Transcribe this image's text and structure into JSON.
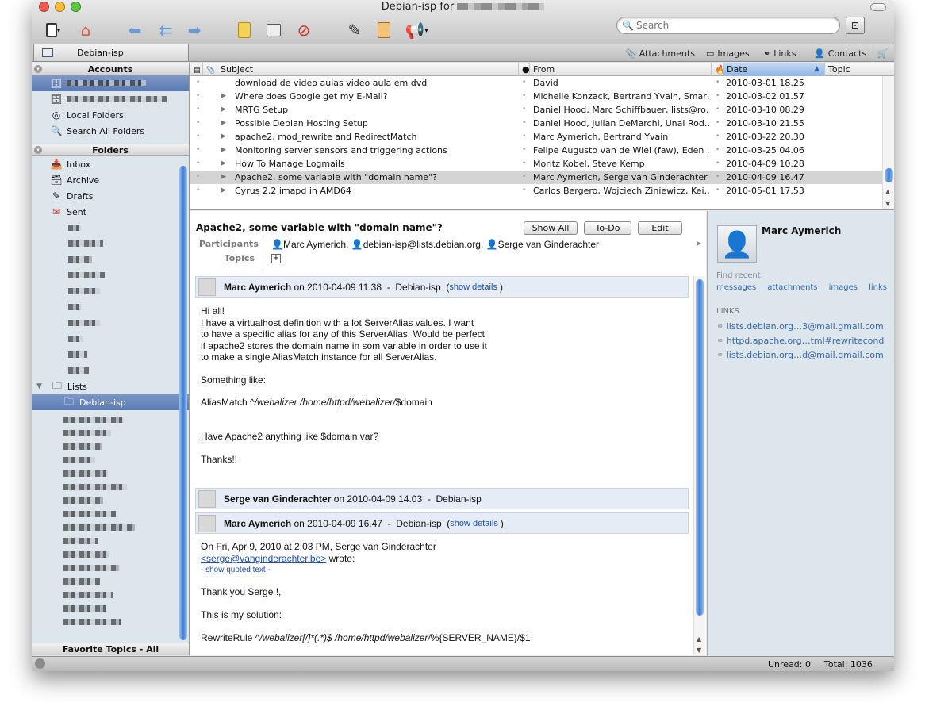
{
  "window": {
    "title": "Debian-isp for",
    "colors": {
      "close": "#ef5a52",
      "minimize": "#f5bd3a",
      "zoom": "#5cc943",
      "selection": "#5a7ab3"
    }
  },
  "toolbar": {
    "icons": [
      "mailbox-icon",
      "home-icon",
      "reply-icon",
      "reply-all-icon",
      "forward-icon",
      "note-icon",
      "archive-icon",
      "delete-icon",
      "compose-icon",
      "clipboard-icon",
      "megaphone-icon"
    ],
    "search_placeholder": "Search"
  },
  "tabbar": {
    "main_tab": "Debian-isp",
    "attachments": "Attachments",
    "images": "Images",
    "links": "Links",
    "contacts": "Contacts"
  },
  "sidebar": {
    "accounts_header": "Accounts",
    "local_folders": "Local Folders",
    "search_all": "Search All Folders",
    "folders_header": "Folders",
    "folders": [
      {
        "label": "Inbox",
        "icon": "inbox-icon"
      },
      {
        "label": "Archive",
        "icon": "archive-icon"
      },
      {
        "label": "Drafts",
        "icon": "drafts-icon"
      },
      {
        "label": "Sent",
        "icon": "sent-icon"
      }
    ],
    "lists": "Lists",
    "selected_list": "Debian-isp",
    "favorite_topics": "Favorite Topics - All"
  },
  "list": {
    "columns": {
      "subject": "Subject",
      "from": "From",
      "date": "Date",
      "topic": "Topic"
    },
    "rows": [
      {
        "subject": "download de video aulas video aula em dvd",
        "from": "David",
        "date": "2010-03-01 18.25",
        "thread": false
      },
      {
        "subject": "Where does Google get my E-Mail?",
        "from": "Michelle Konzack, Bertrand Yvain, Smar…",
        "date": "2010-03-02 01.57",
        "thread": true
      },
      {
        "subject": "MRTG Setup",
        "from": "Daniel Hood, Marc Schiffbauer, lists@ro…",
        "date": "2010-03-10 08.29",
        "thread": true
      },
      {
        "subject": "Possible Debian Hosting Setup",
        "from": "Daniel Hood, Julian DeMarchi, Unai Rod…",
        "date": "2010-03-10 21.55",
        "thread": true
      },
      {
        "subject": "apache2, mod_rewrite and RedirectMatch",
        "from": "Marc Aymerich, Bertrand Yvain",
        "date": "2010-03-22 20.30",
        "thread": true
      },
      {
        "subject": "Monitoring server sensors and triggering actions",
        "from": "Felipe Augusto van de Wiel (faw), Eden …",
        "date": "2010-03-25 04.06",
        "thread": true
      },
      {
        "subject": "How To Manage Logmails",
        "from": "Moritz Kobel, Steve Kemp",
        "date": "2010-04-09 10.28",
        "thread": true
      },
      {
        "subject": "Apache2, some variable with \"domain name\"?",
        "from": "Marc Aymerich, Serge van Ginderachter",
        "date": "2010-04-09 16.47",
        "thread": true,
        "selected": true
      },
      {
        "subject": "Cyrus 2.2 imapd in AMD64",
        "from": "Carlos Bergero, Wojciech Ziniewicz, Kei…",
        "date": "2010-05-01 17.53",
        "thread": true
      }
    ]
  },
  "reader": {
    "title": "Apache2, some variable with \"domain name\"?",
    "show_all": "Show All",
    "todo": "To-Do",
    "edit": "Edit",
    "participants_label": "Participants",
    "topics_label": "Topics",
    "participants": [
      "Marc Aymerich,",
      "debian-isp@lists.debian.org,",
      "Serge van Ginderachter"
    ],
    "messages": [
      {
        "sender": "Marc Aymerich",
        "meta": " on 2010-04-09 11.38  -  Debian-isp  (",
        "details": "show details",
        "close": ")",
        "body": "Hi all!\nI have a virtualhost definition with a lot ServerAlias values. I want\nto have a specific alias for any of this ServerAlias. Would be perfect\nif apache2 stores the domain name in som variable in order to use it\nto make a single AliasMatch instance for all ServerAlias.\n\nSomething like:"
      },
      {
        "sender": "Serge van Ginderachter",
        "meta": " on 2010-04-09 14.03  -  Debian-isp"
      },
      {
        "sender": "Marc Aymerich",
        "meta": " on 2010-04-09 16.47  -  Debian-isp  (",
        "details": "show details",
        "close": ")"
      }
    ],
    "alias_pre": "AliasMatch ^",
    "alias_it": "/webalizer /home/httpd/webalizer/",
    "alias_post": "$domain",
    "body1_tail": "Have Apache2 anything like $domain var?\n\nThanks!!",
    "quote_line": "On Fri, Apr 9, 2010 at 2:03 PM, Serge van Ginderachter",
    "quote_email": "<serge@vanginderachter.be>",
    "quote_wrote": " wrote:",
    "show_quoted": "- show quoted text -",
    "reply_body": "Thank you Serge !,\n\nThis is my solution:",
    "rewrite_pre": "RewriteRule ^",
    "rewrite_it": "/webalizer[/]*(.*)$ /home/httpd/webalizer/",
    "rewrite_post": "%{SERVER_NAME}/$1"
  },
  "people": {
    "name": "Marc Aymerich",
    "find_recent": "Find recent:",
    "recent": [
      "messages",
      "attachments",
      "images",
      "links"
    ],
    "links_header": "LINKS",
    "links": [
      "lists.debian.org…3@mail.gmail.com",
      "httpd.apache.org…tml#rewritecond",
      "lists.debian.org…d@mail.gmail.com"
    ]
  },
  "status": {
    "unread": "Unread: 0",
    "total": "Total: 1036"
  }
}
